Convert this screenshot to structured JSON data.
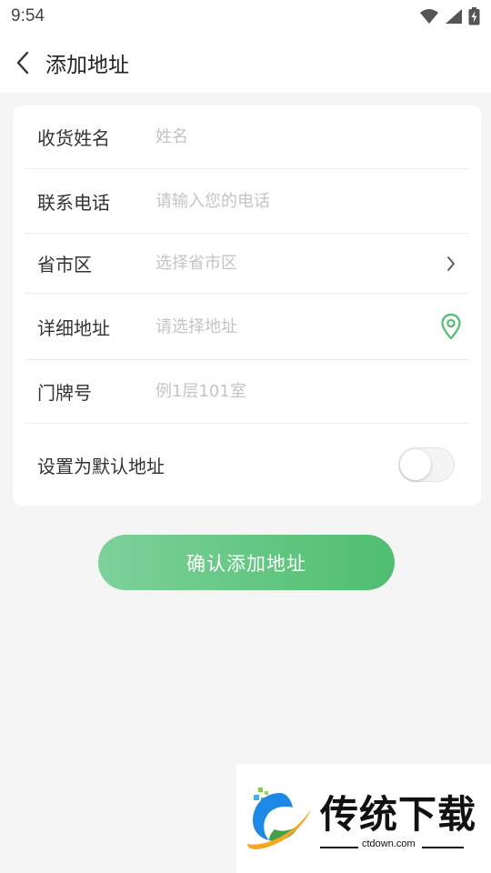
{
  "status_bar": {
    "time": "9:54"
  },
  "header": {
    "title": "添加地址"
  },
  "form": {
    "name": {
      "label": "收货姓名",
      "placeholder": "姓名",
      "value": ""
    },
    "phone": {
      "label": "联系电话",
      "placeholder": "请输入您的电话",
      "value": ""
    },
    "region": {
      "label": "省市区",
      "placeholder": "选择省市区",
      "value": ""
    },
    "address": {
      "label": "详细地址",
      "placeholder": "请选择地址",
      "value": ""
    },
    "door": {
      "label": "门牌号",
      "placeholder": "例1层101室",
      "value": ""
    },
    "default": {
      "label": "设置为默认地址",
      "enabled": false
    }
  },
  "confirm_button": {
    "label": "确认添加地址"
  },
  "watermark": {
    "brand": "传统下载",
    "domain": "ctdown.com"
  },
  "colors": {
    "accent": "#4fbe6f",
    "accent_light": "#7dd19a",
    "background": "#f5f5f5",
    "placeholder": "#c4c4c4"
  },
  "icons": {
    "back": "chevron-left-icon",
    "region_arrow": "chevron-right-icon",
    "location": "location-pin-icon",
    "wifi": "wifi-icon",
    "signal": "cell-signal-icon",
    "battery": "battery-charging-icon"
  }
}
